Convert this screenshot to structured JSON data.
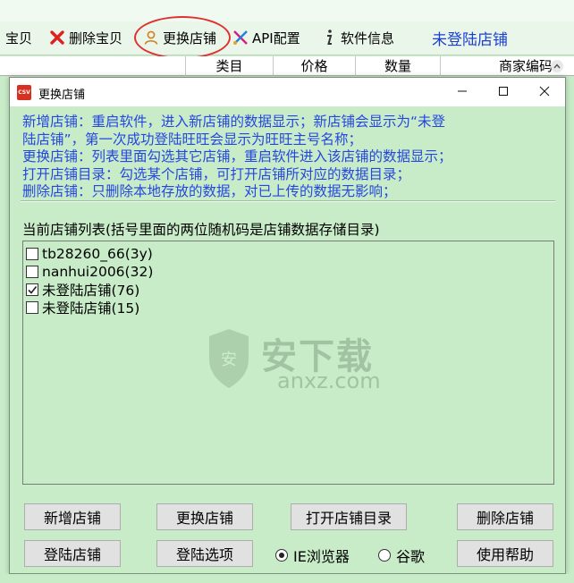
{
  "toolbar": {
    "partial_item_label": "宝贝",
    "delete_item_label": "删除宝贝",
    "change_store_label": "更换店铺",
    "api_config_label": "API配置",
    "software_info_label": "软件信息",
    "login_status": "未登陆店铺",
    "login_status_color": "#1a40d0",
    "highlight_color": "#e03030"
  },
  "grid": {
    "columns": [
      "类目",
      "价格",
      "数量",
      "商家编码"
    ]
  },
  "dialog": {
    "title": "更换店铺",
    "title_icon_text": "CSV",
    "info_lines": [
      "新增店铺：重启软件，进入新店铺的数据显示；新店铺会显示为“未登",
      "陆店铺”，第一次成功登陆旺旺会显示为旺旺主号名称；",
      "更换店铺：列表里面勾选其它店铺，重启软件进入该店铺的数据显示；",
      "打开店铺目录：勾选某个店铺，可打开店铺所对应的数据目录；",
      "删除店铺：只删除本地存放的数据，对已上传的数据无影响；"
    ],
    "info_color": "#2646e0",
    "list_caption": "当前店铺列表(括号里面的两位随机码是店铺数据存储目录)",
    "stores": [
      {
        "label": "tb28260_66(3y)",
        "checked": false
      },
      {
        "label": "nanhui2006(32)",
        "checked": false
      },
      {
        "label": "未登陆店铺(76)",
        "checked": true
      },
      {
        "label": "未登陆店铺(15)",
        "checked": false
      }
    ],
    "watermark": {
      "brand": "安下载",
      "domain": "anxz.com"
    },
    "buttons": {
      "add_store": "新增店铺",
      "change_store": "更换店铺",
      "open_store_dir": "打开店铺目录",
      "delete_store": "删除店铺",
      "login_store": "登陆店铺",
      "login_options": "登陆选项",
      "help": "使用帮助"
    },
    "browser_options": [
      {
        "label": "IE浏览器",
        "selected": true
      },
      {
        "label": "谷歌",
        "selected": false
      }
    ]
  },
  "colors": {
    "background": "#c8ecc8",
    "titlebar": "#ffffff"
  }
}
